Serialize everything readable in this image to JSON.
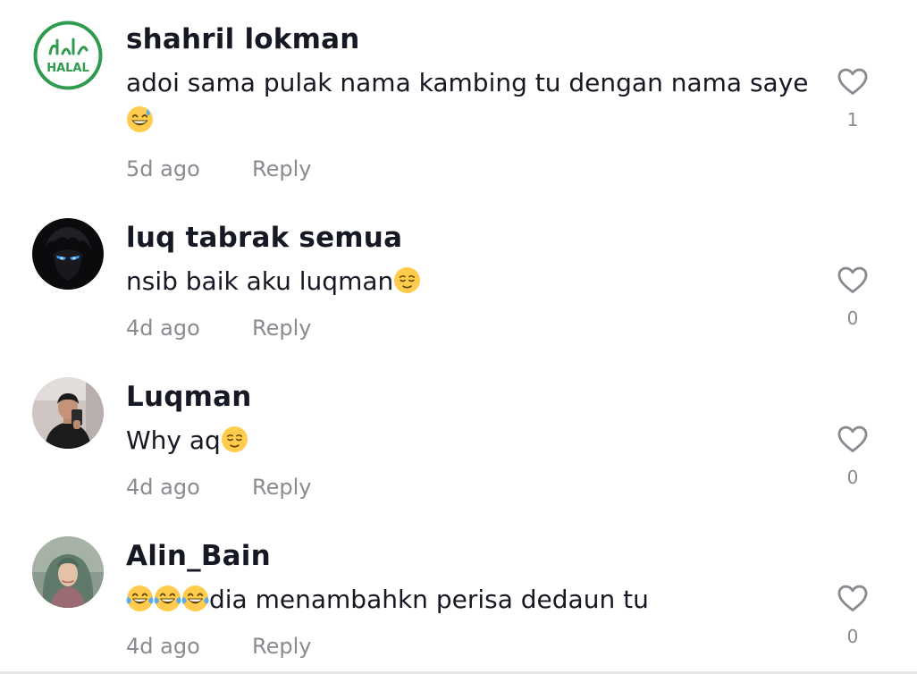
{
  "colors": {
    "text_primary": "#161823",
    "text_secondary": "#8a8b91",
    "halal_green": "#2e9b4e"
  },
  "comments": [
    {
      "username": "shahril lokman",
      "avatar": "halal-logo-avatar",
      "avatar_text": "HALAL",
      "text": "adoi sama pulak nama kambing tu dengan nama saye",
      "emojis": [
        "grinning-sweat-emoji"
      ],
      "time": "5d ago",
      "reply_label": "Reply",
      "likes": "1",
      "like_icon": "heart-outline-icon"
    },
    {
      "username": "luq tabrak semua",
      "avatar": "dark-anime-avatar",
      "text": "nsib baik aku luqman",
      "emojis": [
        "relieved-face-emoji"
      ],
      "time": "4d ago",
      "reply_label": "Reply",
      "likes": "0",
      "like_icon": "heart-outline-icon"
    },
    {
      "username": "Luqman",
      "avatar": "mirror-selfie-avatar",
      "text": "Why aq",
      "emojis": [
        "relieved-face-emoji"
      ],
      "time": "4d ago",
      "reply_label": "Reply",
      "likes": "0",
      "like_icon": "heart-outline-icon"
    },
    {
      "username": "Alin_Bain",
      "avatar": "hijab-woman-avatar",
      "text": "dia menambahkn perisa dedaun tu",
      "emojis": [
        "tears-of-joy-emoji",
        "tears-of-joy-emoji",
        "tears-of-joy-emoji"
      ],
      "time": "4d ago",
      "reply_label": "Reply",
      "likes": "0",
      "like_icon": "heart-outline-icon"
    }
  ]
}
